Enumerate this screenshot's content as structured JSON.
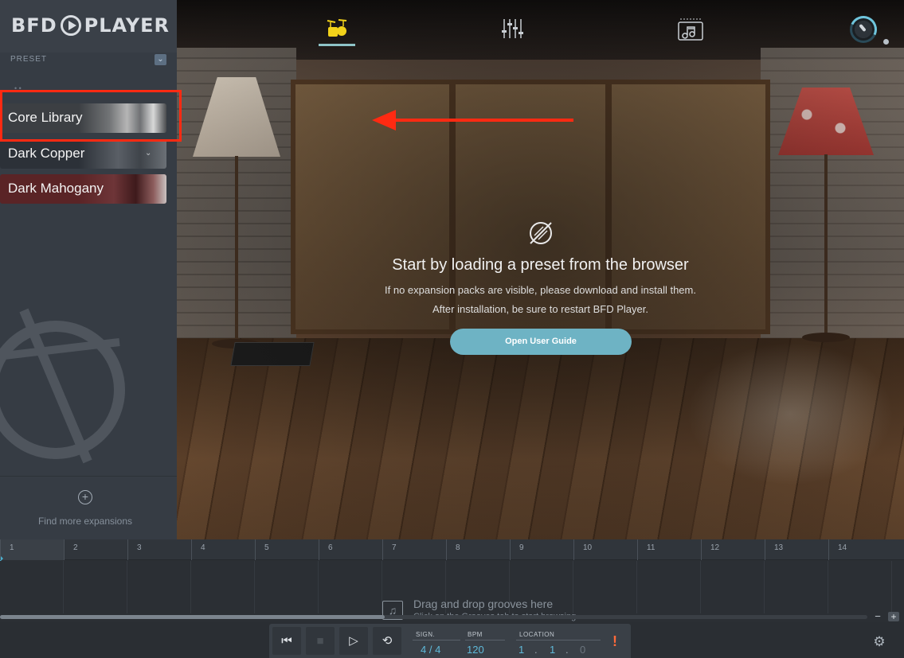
{
  "app": {
    "name": "BFD PLAYER",
    "logo_left": "BFD",
    "logo_right": "PLAYER"
  },
  "sidebar": {
    "section_label": "PRESET",
    "libraries": [
      {
        "label": "Core Library",
        "highlighted": true
      },
      {
        "label": "Dark Copper"
      },
      {
        "label": "Dark Mahogany"
      }
    ],
    "footer_label": "Find more expansions",
    "footer_icon": "plus-circle-icon"
  },
  "nav": {
    "tabs": [
      {
        "id": "kit",
        "icon": "drum-kit-icon",
        "active": true
      },
      {
        "id": "mixer",
        "icon": "mixer-faders-icon",
        "active": false
      },
      {
        "id": "grooves",
        "icon": "grooves-music-note-icon",
        "active": false
      }
    ],
    "active_underline_color": "#8ec4c8"
  },
  "empty_state": {
    "title": "Start by loading a preset from the browser",
    "line1": "If no expansion packs are visible, please download and install them.",
    "line2": "After installation, be sure to restart BFD Player.",
    "button_label": "Open User Guide",
    "button_color": "#6eb3c4"
  },
  "annotation": {
    "color": "#ff2a12",
    "target": "Core Library"
  },
  "timeline": {
    "bars": [
      "1",
      "2",
      "3",
      "4",
      "5",
      "6",
      "7",
      "8",
      "9",
      "10",
      "11",
      "12",
      "13",
      "14"
    ],
    "drop_title": "Drag and drop grooves here",
    "drop_subtitle": "Click on the Grooves tab to start browsing",
    "zoom_out": "−",
    "zoom_in": "+"
  },
  "transport": {
    "sign_label": "SIGN.",
    "sign_value": "4 / 4",
    "bpm_label": "BPM",
    "bpm_value": "120",
    "location_label": "LOCATION",
    "location_bar": "1",
    "location_beat": "1",
    "location_tick": "0",
    "location_sep": ".",
    "value_color": "#5fb9d9",
    "alert_glyph": "!"
  }
}
